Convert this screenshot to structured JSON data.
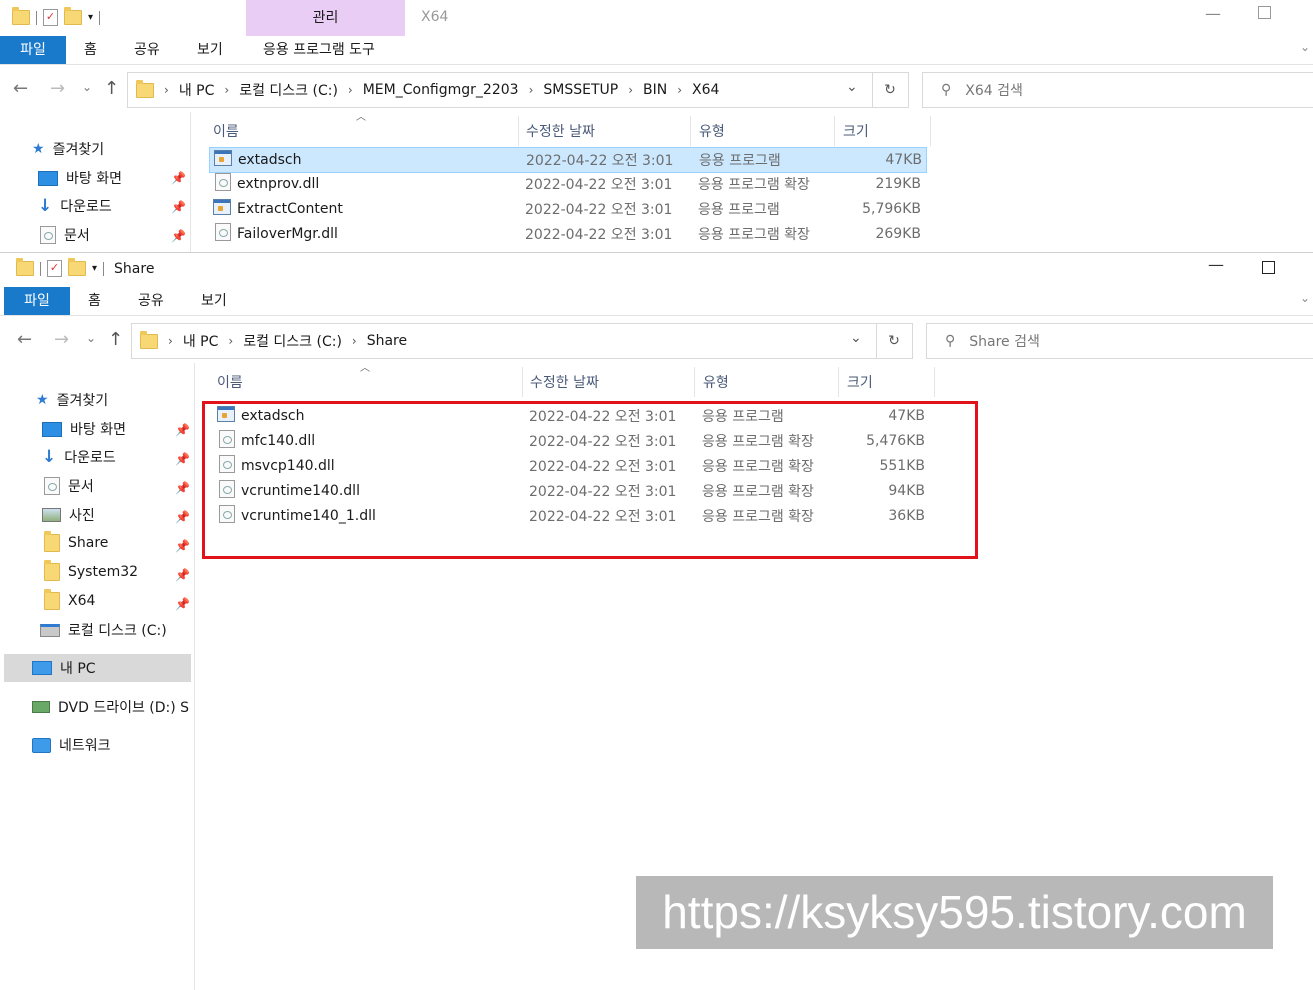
{
  "back_window": {
    "title_tab": "관리",
    "title_path": "X64",
    "ribbon_tabs": [
      "파일",
      "홈",
      "공유",
      "보기"
    ],
    "ribbon_context_tab": "응용 프로그램 도구",
    "breadcrumb": [
      "내 PC",
      "로컬 디스크 (C:)",
      "MEM_Configmgr_2203",
      "SMSSETUP",
      "BIN",
      "X64"
    ],
    "search_placeholder": "X64 검색",
    "nav": [
      {
        "label": "즐겨찾기",
        "icon": "star-icon"
      },
      {
        "label": "바탕 화면",
        "icon": "desktop-icon"
      },
      {
        "label": "다운로드",
        "icon": "download-icon"
      },
      {
        "label": "문서",
        "icon": "document-icon"
      }
    ],
    "columns": [
      "이름",
      "수정한 날짜",
      "유형",
      "크기"
    ],
    "files": [
      {
        "name": "extadsch",
        "date": "2022-04-22 오전 3:01",
        "type": "응용 프로그램",
        "size": "47KB",
        "icon": "exe-icon",
        "selected": true
      },
      {
        "name": "extnprov.dll",
        "date": "2022-04-22 오전 3:01",
        "type": "응용 프로그램 확장",
        "size": "219KB",
        "icon": "dll-icon"
      },
      {
        "name": "ExtractContent",
        "date": "2022-04-22 오전 3:01",
        "type": "응용 프로그램",
        "size": "5,796KB",
        "icon": "exe-icon"
      },
      {
        "name": "FailoverMgr.dll",
        "date": "2022-04-22 오전 3:01",
        "type": "응용 프로그램 확장",
        "size": "269KB",
        "icon": "dll-icon"
      }
    ]
  },
  "front_window": {
    "title": "Share",
    "ribbon_tabs": [
      "파일",
      "홈",
      "공유",
      "보기"
    ],
    "breadcrumb": [
      "내 PC",
      "로컬 디스크 (C:)",
      "Share"
    ],
    "search_placeholder": "Share 검색",
    "nav": [
      {
        "label": "즐겨찾기",
        "icon": "star-icon",
        "pinned": false
      },
      {
        "label": "바탕 화면",
        "icon": "desktop-icon",
        "pinned": true
      },
      {
        "label": "다운로드",
        "icon": "download-icon",
        "pinned": true
      },
      {
        "label": "문서",
        "icon": "document-icon",
        "pinned": true
      },
      {
        "label": "사진",
        "icon": "pictures-icon",
        "pinned": true
      },
      {
        "label": "Share",
        "icon": "folder-icon",
        "pinned": true
      },
      {
        "label": "System32",
        "icon": "folder-icon",
        "pinned": true
      },
      {
        "label": "X64",
        "icon": "folder-icon",
        "pinned": true
      },
      {
        "label": "로컬 디스크 (C:)",
        "icon": "drive-icon",
        "pinned": false
      },
      {
        "label": "내 PC",
        "icon": "pc-icon",
        "pinned": false,
        "selected": true
      },
      {
        "label": "DVD 드라이브 (D:) S",
        "icon": "dvd-icon",
        "pinned": false
      },
      {
        "label": "네트워크",
        "icon": "network-icon",
        "pinned": false
      }
    ],
    "columns": [
      "이름",
      "수정한 날짜",
      "유형",
      "크기"
    ],
    "files": [
      {
        "name": "extadsch",
        "date": "2022-04-22 오전 3:01",
        "type": "응용 프로그램",
        "size": "47KB",
        "icon": "exe-icon"
      },
      {
        "name": "mfc140.dll",
        "date": "2022-04-22 오전 3:01",
        "type": "응용 프로그램 확장",
        "size": "5,476KB",
        "icon": "dll-icon"
      },
      {
        "name": "msvcp140.dll",
        "date": "2022-04-22 오전 3:01",
        "type": "응용 프로그램 확장",
        "size": "551KB",
        "icon": "dll-icon"
      },
      {
        "name": "vcruntime140.dll",
        "date": "2022-04-22 오전 3:01",
        "type": "응용 프로그램 확장",
        "size": "94KB",
        "icon": "dll-icon"
      },
      {
        "name": "vcruntime140_1.dll",
        "date": "2022-04-22 오전 3:01",
        "type": "응용 프로그램 확장",
        "size": "36KB",
        "icon": "dll-icon"
      }
    ],
    "highlight_color": "#e2121b"
  },
  "watermark": "https://ksyksy595.tistory.com",
  "colors": {
    "accent": "#1979ca",
    "selected_row": "#cce8ff",
    "context_tab": "#e9cdf5",
    "nav_selected": "#d9d9d9"
  }
}
